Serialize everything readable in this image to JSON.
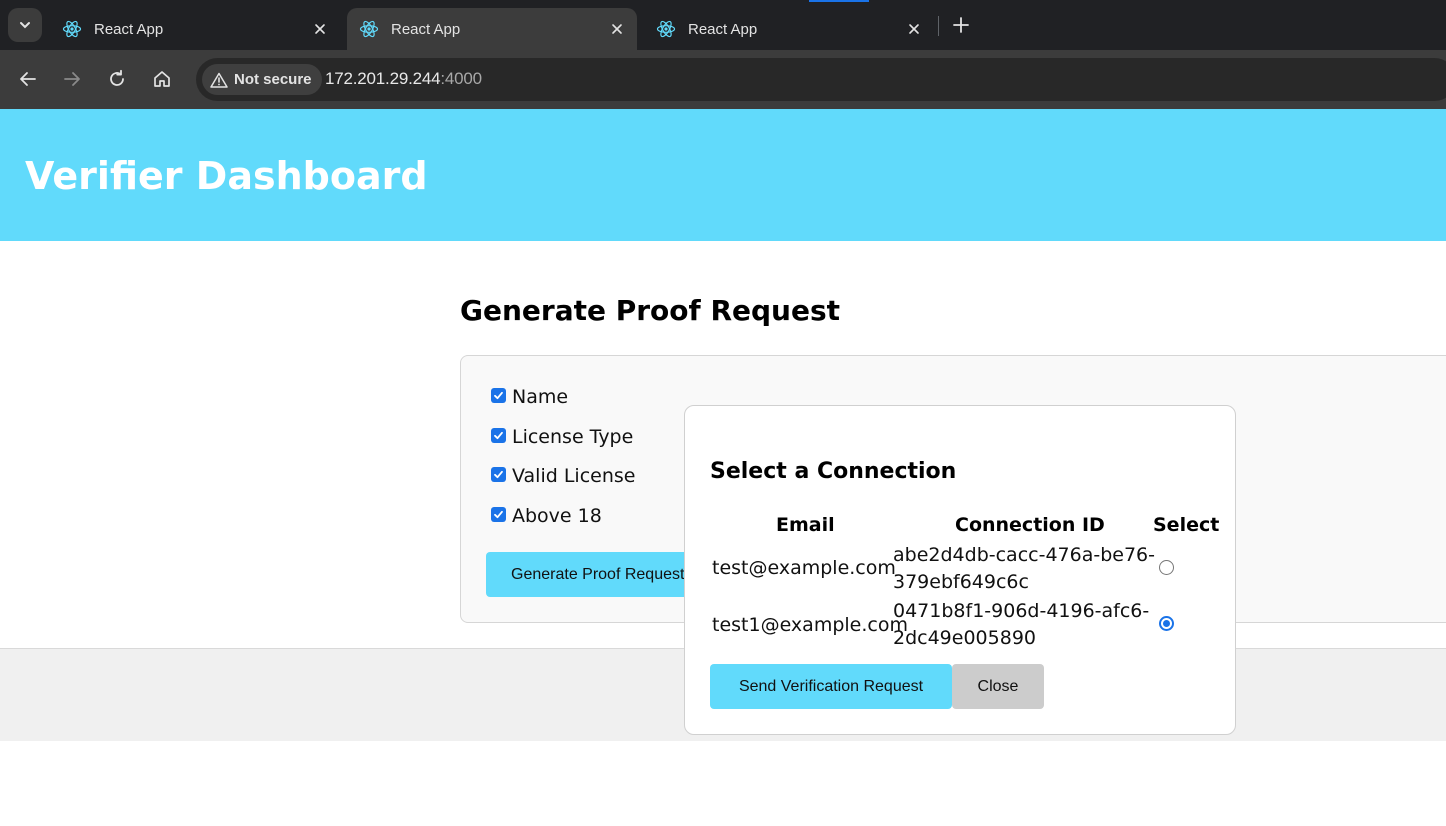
{
  "browser": {
    "tabs": [
      {
        "title": "React App",
        "icon": "react-icon",
        "active": false
      },
      {
        "title": "React App",
        "icon": "react-icon",
        "active": true
      },
      {
        "title": "React App",
        "icon": "react-icon",
        "active": false
      }
    ],
    "security_label": "Not secure",
    "url_host": "172.201.29.244",
    "url_port": ":4000"
  },
  "header": {
    "title": "Verifier Dashboard"
  },
  "proof_request": {
    "title": "Generate Proof Request",
    "attributes": [
      {
        "label": "Name",
        "checked": true
      },
      {
        "label": "License Type",
        "checked": true
      },
      {
        "label": "Valid License",
        "checked": true
      },
      {
        "label": "Above 18",
        "checked": true
      }
    ],
    "button_label": "Generate Proof Request"
  },
  "modal": {
    "title": "Select a Connection",
    "columns": [
      "Email",
      "Connection ID",
      "Select"
    ],
    "rows": [
      {
        "email": "test@example.com",
        "id_line1": "abe2d4db-cacc-476a-be76-",
        "id_line2": "379ebf649c6c",
        "selected": false
      },
      {
        "email": "test1@example.com",
        "id_line1": "0471b8f1-906d-4196-afc6-",
        "id_line2": "2dc49e005890",
        "selected": true
      }
    ],
    "send_label": "Send Verification Request",
    "close_label": "Close"
  },
  "colors": {
    "accent": "#61dafb",
    "chrome_dark": "#202124",
    "radio_blue": "#1a73e8"
  }
}
